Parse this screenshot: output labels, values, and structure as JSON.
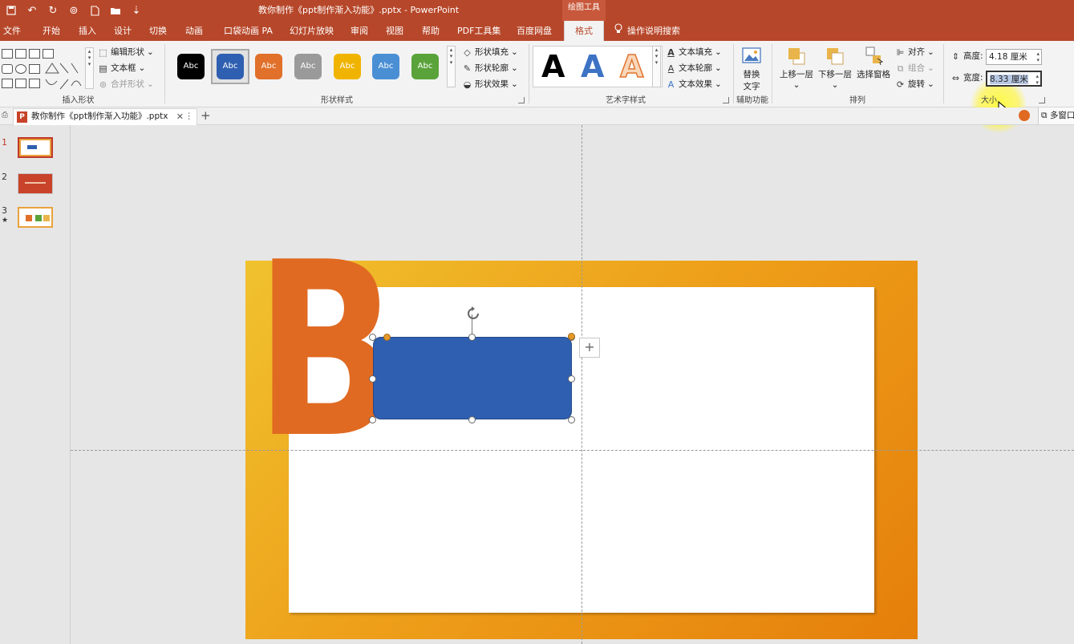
{
  "app": {
    "title": "教你制作《ppt制作渐入功能》.pptx - PowerPoint",
    "context_group": "绘图工具"
  },
  "tabs": [
    "文件",
    "开始",
    "插入",
    "设计",
    "切换",
    "动画",
    "口袋动画 PA",
    "幻灯片放映",
    "审阅",
    "视图",
    "帮助",
    "PDF工具集",
    "百度网盘",
    "格式"
  ],
  "active_tab": "格式",
  "search": {
    "label": "操作说明搜索"
  },
  "ribbon": {
    "insert_shapes": {
      "label": "插入形状",
      "edit_shape": "编辑形状",
      "text_box": "文本框",
      "merge_shapes": "合并形状"
    },
    "shape_styles": {
      "label": "形状样式",
      "swatch_text": "Abc",
      "swatches": [
        "#000000",
        "#2f5fb0",
        "#e0702a",
        "#9a9a9a",
        "#f0b400",
        "#4a8fd4",
        "#5aa33a"
      ],
      "fill": "形状填充",
      "outline": "形状轮廓",
      "effects": "形状效果"
    },
    "wordart": {
      "label": "艺术字样式",
      "letters": [
        "A",
        "A",
        "A"
      ],
      "text_fill": "文本填充",
      "text_outline": "文本轮廓",
      "text_effects": "文本效果"
    },
    "accessibility": {
      "label": "辅助功能",
      "alt_text_line1": "替换",
      "alt_text_line2": "文字"
    },
    "arrange": {
      "label": "排列",
      "bring_forward": "上移一层",
      "send_backward": "下移一层",
      "selection_pane": "选择窗格",
      "align": "对齐",
      "group": "组合",
      "rotate": "旋转"
    },
    "size": {
      "label": "大小",
      "height_label": "高度:",
      "height_value": "4.18 厘米",
      "width_label": "宽度:",
      "width_value": "8.33 厘米"
    }
  },
  "doc_tab": {
    "name": "教你制作《ppt制作渐入功能》.pptx",
    "multi_window": "多窗口"
  },
  "slides": [
    {
      "num": "1",
      "star": ""
    },
    {
      "num": "2",
      "star": ""
    },
    {
      "num": "3",
      "star": "★"
    }
  ],
  "slide_letter": "B",
  "colors": {
    "accent": "#b7472a",
    "shape_fill": "#2f5fb0",
    "letter": "#e06a22"
  }
}
